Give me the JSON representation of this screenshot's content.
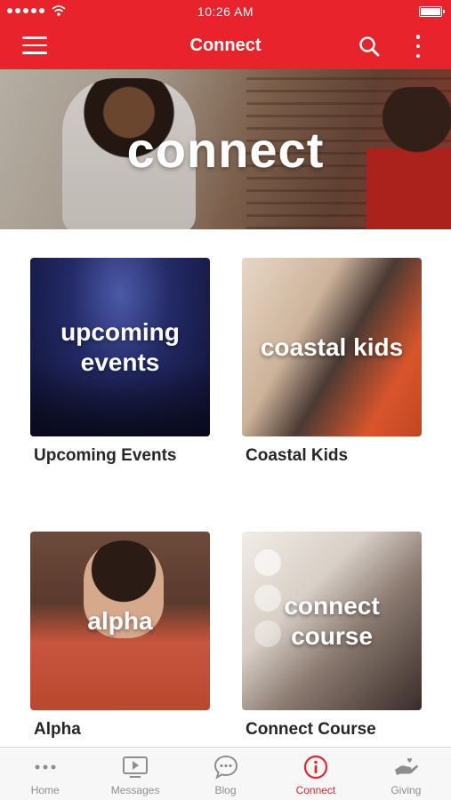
{
  "status_bar": {
    "time": "10:26 AM"
  },
  "nav": {
    "title": "Connect"
  },
  "hero": {
    "title": "connect"
  },
  "cards": [
    {
      "overlay": "upcoming events",
      "label": "Upcoming Events"
    },
    {
      "overlay": "coastal kids",
      "label": "Coastal Kids"
    },
    {
      "overlay": "alpha",
      "label": "Alpha"
    },
    {
      "overlay": "connect course",
      "label": "Connect Course"
    }
  ],
  "tabs": [
    {
      "label": "Home",
      "icon": "more-dots-icon"
    },
    {
      "label": "Messages",
      "icon": "video-play-icon"
    },
    {
      "label": "Blog",
      "icon": "chat-bubble-icon"
    },
    {
      "label": "Connect",
      "icon": "info-circle-icon",
      "active": true
    },
    {
      "label": "Giving",
      "icon": "giving-hand-icon"
    }
  ],
  "colors": {
    "brand_red": "#e8232b",
    "tab_inactive": "#8e8e8e",
    "tab_bar_bg": "#f7f7f7"
  }
}
